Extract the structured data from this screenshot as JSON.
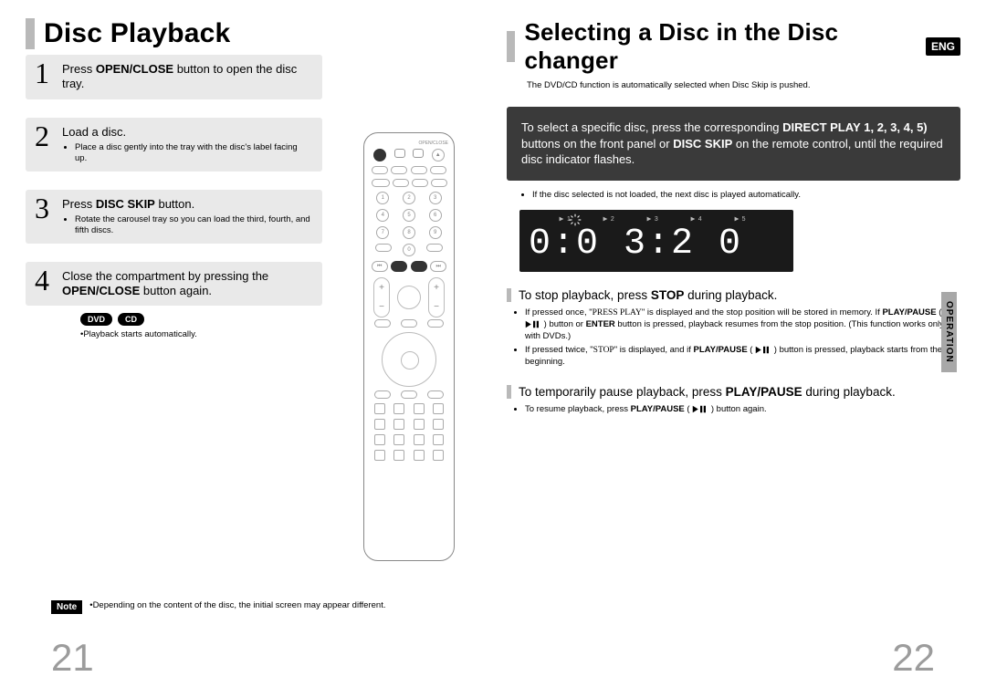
{
  "left": {
    "title": "Disc Playback",
    "steps": [
      {
        "num": "1",
        "main_pre": "Press ",
        "main_bold": "OPEN/CLOSE",
        "main_post": " button to open the disc tray.",
        "sub": []
      },
      {
        "num": "2",
        "main_pre": "Load a disc.",
        "main_bold": "",
        "main_post": "",
        "sub": [
          "Place a disc gently into the tray with the disc's label facing up."
        ]
      },
      {
        "num": "3",
        "main_pre": "Press ",
        "main_bold": "DISC SKIP",
        "main_post": " button.",
        "sub": [
          "Rotate the carousel tray so you can load the third, fourth, and fifth discs."
        ]
      },
      {
        "num": "4",
        "main_pre": "Close the compartment by pressing the ",
        "main_bold": "OPEN/CLOSE",
        "main_post": " button again.",
        "sub": []
      }
    ],
    "badges": [
      "DVD",
      "CD"
    ],
    "post_step_note": "Playback starts automatically.",
    "note_label": "Note",
    "note_text": "Depending on the content of the disc, the initial screen may appear different.",
    "page_num": "21"
  },
  "right": {
    "title": "Selecting a Disc in the Disc changer",
    "lang_badge": "ENG",
    "sub_note": "The DVD/CD function is automatically selected when Disc Skip is pushed.",
    "dark_box": {
      "line1_pre": "To select a specific disc, press the corresponding ",
      "line1_bold": "DIRECT PLAY",
      "line2_bold1": "1, 2, 3, 4, 5)",
      "line2_mid": " buttons on the front panel or ",
      "line2_bold2": "DISC SKIP",
      "line2_post": " on the remote control, until the required disc indicator flashes."
    },
    "dark_bullets": [
      "If the disc selected is not loaded, the next disc is played automatically."
    ],
    "display_indicators": [
      "1",
      "2",
      "3",
      "4",
      "5"
    ],
    "display_time": "0:0 3:2 0",
    "sections": [
      {
        "heading_pre": "To stop playback, press ",
        "heading_bold": "STOP",
        "heading_post": " during playback.",
        "bullets": [
          {
            "pre": "If pressed once, \"",
            "sc1": "PRESS PLAY",
            "mid1": "\" is displayed and the stop position will be stored in memory.\nIf ",
            "b1": "PLAY/PAUSE",
            "mid2": " ( ",
            "icon": true,
            "mid3": " ) button or ",
            "b2": "ENTER",
            "mid4": " button is pressed, playback resumes from the stop position.\n(This function works only with DVDs.)"
          },
          {
            "pre": "If pressed twice, \"",
            "sc1": "STOP",
            "mid1": "\" is displayed, and if ",
            "b1": "PLAY/PAUSE",
            "mid2": " ( ",
            "icon": true,
            "mid3": " ) button is pressed, playback starts from the beginning."
          }
        ]
      },
      {
        "heading_pre": "To temporarily pause playback, press ",
        "heading_bold": "PLAY/PAUSE",
        "heading_post": " during playback.",
        "bullets": [
          {
            "pre": "To resume playback, press ",
            "b1": "PLAY/PAUSE",
            "mid2": " ( ",
            "icon": true,
            "mid3": " ) button again."
          }
        ]
      }
    ],
    "side_tab": "OPERATION",
    "page_num": "22"
  },
  "remote": {
    "top_labels": [
      "",
      "OPEN/CLOSE"
    ],
    "keypad": [
      "1",
      "2",
      "3",
      "4",
      "5",
      "6",
      "7",
      "8",
      "9",
      "0"
    ]
  }
}
